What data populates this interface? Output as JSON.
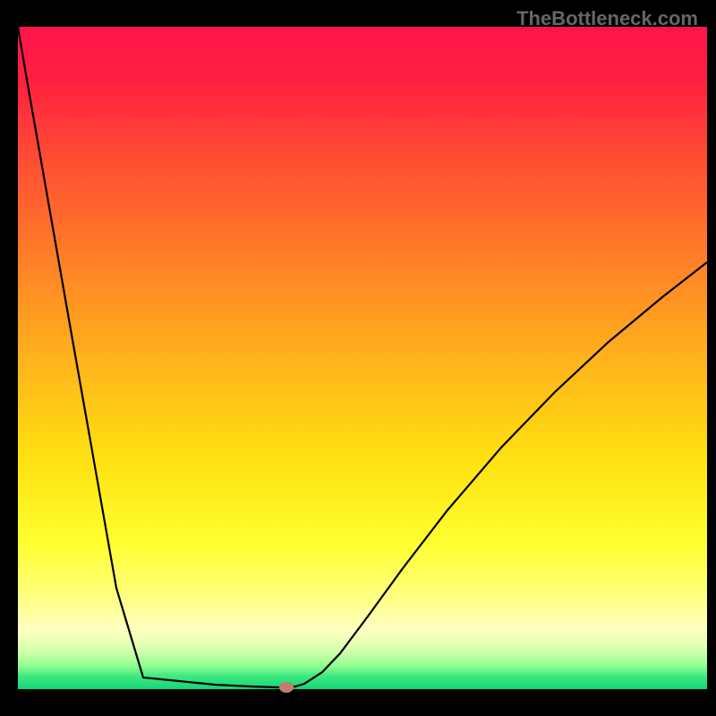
{
  "watermark": "TheBottleneck.com",
  "chart_data": {
    "type": "line",
    "title": "",
    "xlabel": "",
    "ylabel": "",
    "x": [
      20,
      30,
      40,
      50,
      60,
      80,
      100,
      130,
      160,
      200,
      240,
      280,
      310,
      320,
      330,
      340,
      360,
      380,
      410,
      450,
      500,
      560,
      620,
      680,
      740,
      790
    ],
    "values": [
      0,
      59,
      116,
      173,
      230,
      344,
      457,
      627,
      727,
      731,
      735,
      737,
      738,
      738,
      737,
      734,
      721,
      700,
      660,
      605,
      540,
      470,
      408,
      352,
      302,
      263
    ],
    "xlim": [
      20,
      790
    ],
    "ylim": [
      0,
      740
    ],
    "marker": {
      "x": 320,
      "y": 738
    },
    "background": "rainbow-vertical-gradient",
    "note": "V-shaped bottleneck curve; y expressed as pixels from top of 740px plot area; minimum (optimum) at x≈320."
  },
  "colors": {
    "frame": "#000000",
    "curve": "#000000",
    "marker": "#c77a6e"
  }
}
